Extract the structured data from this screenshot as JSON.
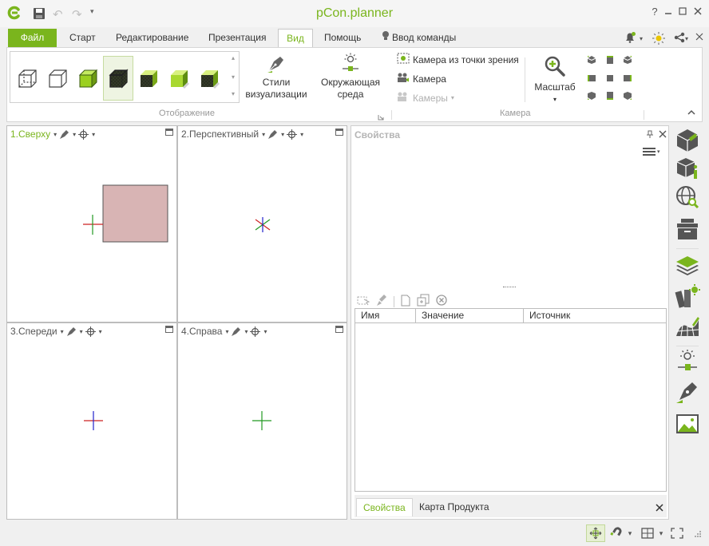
{
  "window": {
    "title": "pCon.planner",
    "help": "?"
  },
  "quick_access": {
    "save": "save-icon",
    "undo": "↶",
    "redo": "↷",
    "more": "▾"
  },
  "tabs": [
    {
      "label": "Файл"
    },
    {
      "label": "Старт"
    },
    {
      "label": "Редактирование"
    },
    {
      "label": "Презентация"
    },
    {
      "label": "Вид"
    },
    {
      "label": "Помощь"
    }
  ],
  "command_input": {
    "label": "Ввод команды"
  },
  "ribbon": {
    "groups": {
      "display": "Отображение",
      "camera": "Камера"
    },
    "buttons": {
      "styles": [
        "Стили",
        "визуализации"
      ],
      "environment": [
        "Окружающая",
        "среда"
      ],
      "camera_viewpoint": "Камера из точки зрения",
      "camera": "Камера",
      "cameras": "Камеры",
      "zoom": "Масштаб"
    }
  },
  "viewports": [
    {
      "label": "1.Сверху"
    },
    {
      "label": "2.Перспективный"
    },
    {
      "label": "3.Спереди"
    },
    {
      "label": "4.Справа"
    }
  ],
  "properties": {
    "title": "Свойства",
    "columns": [
      "Имя",
      "Значение",
      "Источник"
    ],
    "tabs": [
      "Свойства",
      "Карта Продукта"
    ]
  },
  "colors": {
    "accent": "#7ab51d",
    "object_fill": "#d8b4b4",
    "axis_x": "#cc2222",
    "axis_y": "#229922",
    "axis_z": "#2222cc"
  }
}
